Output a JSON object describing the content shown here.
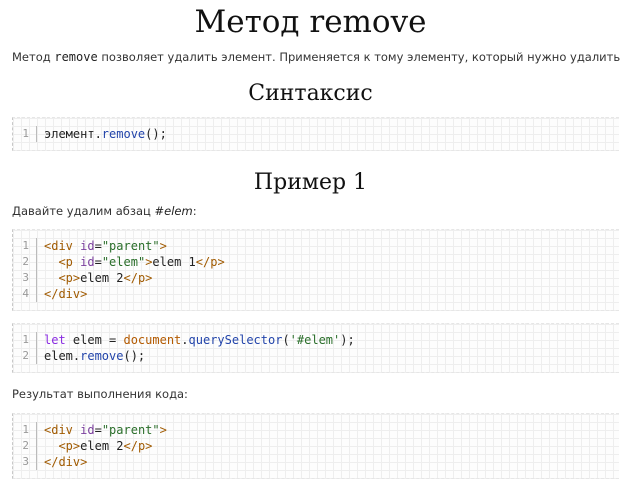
{
  "page": {
    "title": "Метод remove",
    "intro": {
      "before": "Метод ",
      "code": "remove",
      "after": " позволяет удалить элемент. Применяется к тому элементу, который нужно удалить."
    },
    "syntax_heading": "Синтаксис",
    "example_heading": "Пример 1",
    "example_text": {
      "before": "Давайте удалим абзац ",
      "selector": "#elem",
      "after": ":"
    },
    "result_text": "Результат выполнения кода:"
  },
  "code_blocks": {
    "syntax": [
      {
        "n": "1",
        "tokens": [
          [
            "txt",
            "элемент."
          ],
          [
            "fn",
            "remove"
          ],
          [
            "txt",
            "();"
          ]
        ]
      }
    ],
    "html_example": [
      {
        "n": "1",
        "tokens": [
          [
            "tag",
            "<div"
          ],
          [
            "txt",
            " "
          ],
          [
            "attr",
            "id"
          ],
          [
            "txt",
            "="
          ],
          [
            "str",
            "\"parent\""
          ],
          [
            "tag",
            ">"
          ]
        ]
      },
      {
        "n": "2",
        "tokens": [
          [
            "txt",
            "  "
          ],
          [
            "tag",
            "<p"
          ],
          [
            "txt",
            " "
          ],
          [
            "attr",
            "id"
          ],
          [
            "txt",
            "="
          ],
          [
            "str",
            "\"elem\""
          ],
          [
            "tag",
            ">"
          ],
          [
            "txt",
            "elem 1"
          ],
          [
            "tag",
            "</p>"
          ]
        ]
      },
      {
        "n": "3",
        "tokens": [
          [
            "txt",
            "  "
          ],
          [
            "tag",
            "<p>"
          ],
          [
            "txt",
            "elem 2"
          ],
          [
            "tag",
            "</p>"
          ]
        ]
      },
      {
        "n": "4",
        "tokens": [
          [
            "tag",
            "</div>"
          ]
        ]
      }
    ],
    "js_example": [
      {
        "n": "1",
        "tokens": [
          [
            "kw",
            "let"
          ],
          [
            "txt",
            " elem = "
          ],
          [
            "obj",
            "document"
          ],
          [
            "txt",
            "."
          ],
          [
            "fn",
            "querySelector"
          ],
          [
            "txt",
            "("
          ],
          [
            "str",
            "'#elem'"
          ],
          [
            "txt",
            ");"
          ]
        ]
      },
      {
        "n": "2",
        "tokens": [
          [
            "txt",
            "elem."
          ],
          [
            "fn",
            "remove"
          ],
          [
            "txt",
            "();"
          ]
        ]
      }
    ],
    "result": [
      {
        "n": "1",
        "tokens": [
          [
            "tag",
            "<div"
          ],
          [
            "txt",
            " "
          ],
          [
            "attr",
            "id"
          ],
          [
            "txt",
            "="
          ],
          [
            "str",
            "\"parent\""
          ],
          [
            "tag",
            ">"
          ]
        ]
      },
      {
        "n": "2",
        "tokens": [
          [
            "txt",
            "  "
          ],
          [
            "tag",
            "<p>"
          ],
          [
            "txt",
            "elem 2"
          ],
          [
            "tag",
            "</p>"
          ]
        ]
      },
      {
        "n": "3",
        "tokens": [
          [
            "tag",
            "</div>"
          ]
        ]
      }
    ]
  }
}
